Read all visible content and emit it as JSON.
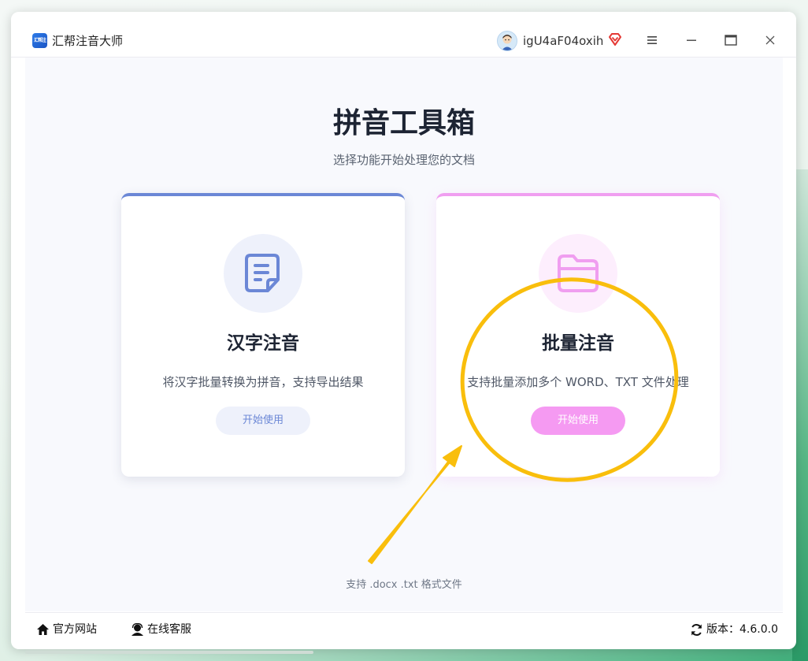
{
  "window": {
    "title": "汇帮注音大师",
    "logo_text": "汇帮注音"
  },
  "user": {
    "name": "igU4aF04oxih",
    "badge_icon": "vip-diamond-icon",
    "badge_color": "#e53935"
  },
  "titlebar_controls": [
    "menu-icon",
    "minimize-icon",
    "maximize-icon",
    "close-icon"
  ],
  "main": {
    "title": "拼音工具箱",
    "subtitle": "选择功能开始处理您的文档",
    "cards": [
      {
        "title": "汉字注音",
        "description": "将汉字批量转换为拼音，支持导出结果",
        "button": "开始使用",
        "icon": "document-icon",
        "accent": "#6b87d6"
      },
      {
        "title": "批量注音",
        "description": "支持批量添加多个 WORD、TXT 文件处理",
        "button": "开始使用",
        "icon": "folder-icon",
        "accent": "#f09ef0"
      }
    ],
    "footnote": "支持 .docx .txt 格式文件"
  },
  "statusbar": {
    "website": "官方网站",
    "support": "在线客服",
    "version_label": "版本：4.6.0.0"
  },
  "annotation": {
    "color": "#f9be0c",
    "shape": "circle-with-arrow"
  }
}
